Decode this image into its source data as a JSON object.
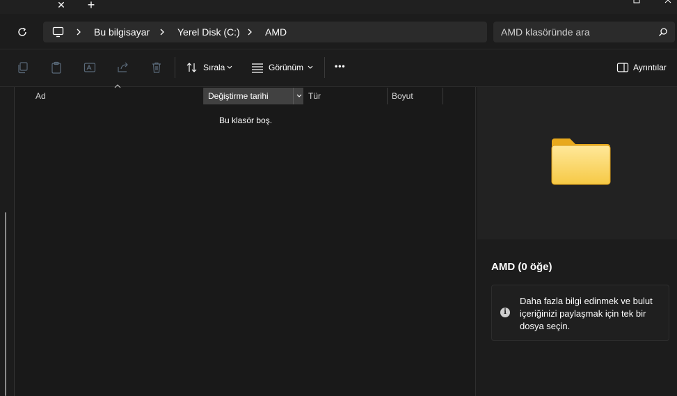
{
  "window": {
    "tab_close_glyph": "✕",
    "tab_new_glyph": "+"
  },
  "address_bar": {
    "breadcrumbs": [
      "Bu bilgisayar",
      "Yerel Disk (C:)",
      "AMD"
    ]
  },
  "search": {
    "placeholder": "AMD klasöründe ara"
  },
  "commands": {
    "icons": [
      "copy-icon",
      "paste-icon",
      "rename-icon",
      "share-icon",
      "delete-icon"
    ],
    "sort_label": "Sırala",
    "view_label": "Görünüm",
    "more_glyph": "•••",
    "details_label": "Ayrıntılar"
  },
  "file_list": {
    "columns": [
      "Ad",
      "Değiştirme tarihi",
      "Tür",
      "Boyut"
    ],
    "empty_message": "Bu klasör boş."
  },
  "details_pane": {
    "title": "AMD (0 öğe)",
    "info_glyph": "i",
    "info_text": "Daha fazla bilgi edinmek ve bulut içeriğinizi paylaşmak için tek bir dosya seçin."
  },
  "colors": {
    "background": "#1c1c1c",
    "surface": "#2b2b2b",
    "folder_yellow": "#f7c948"
  }
}
